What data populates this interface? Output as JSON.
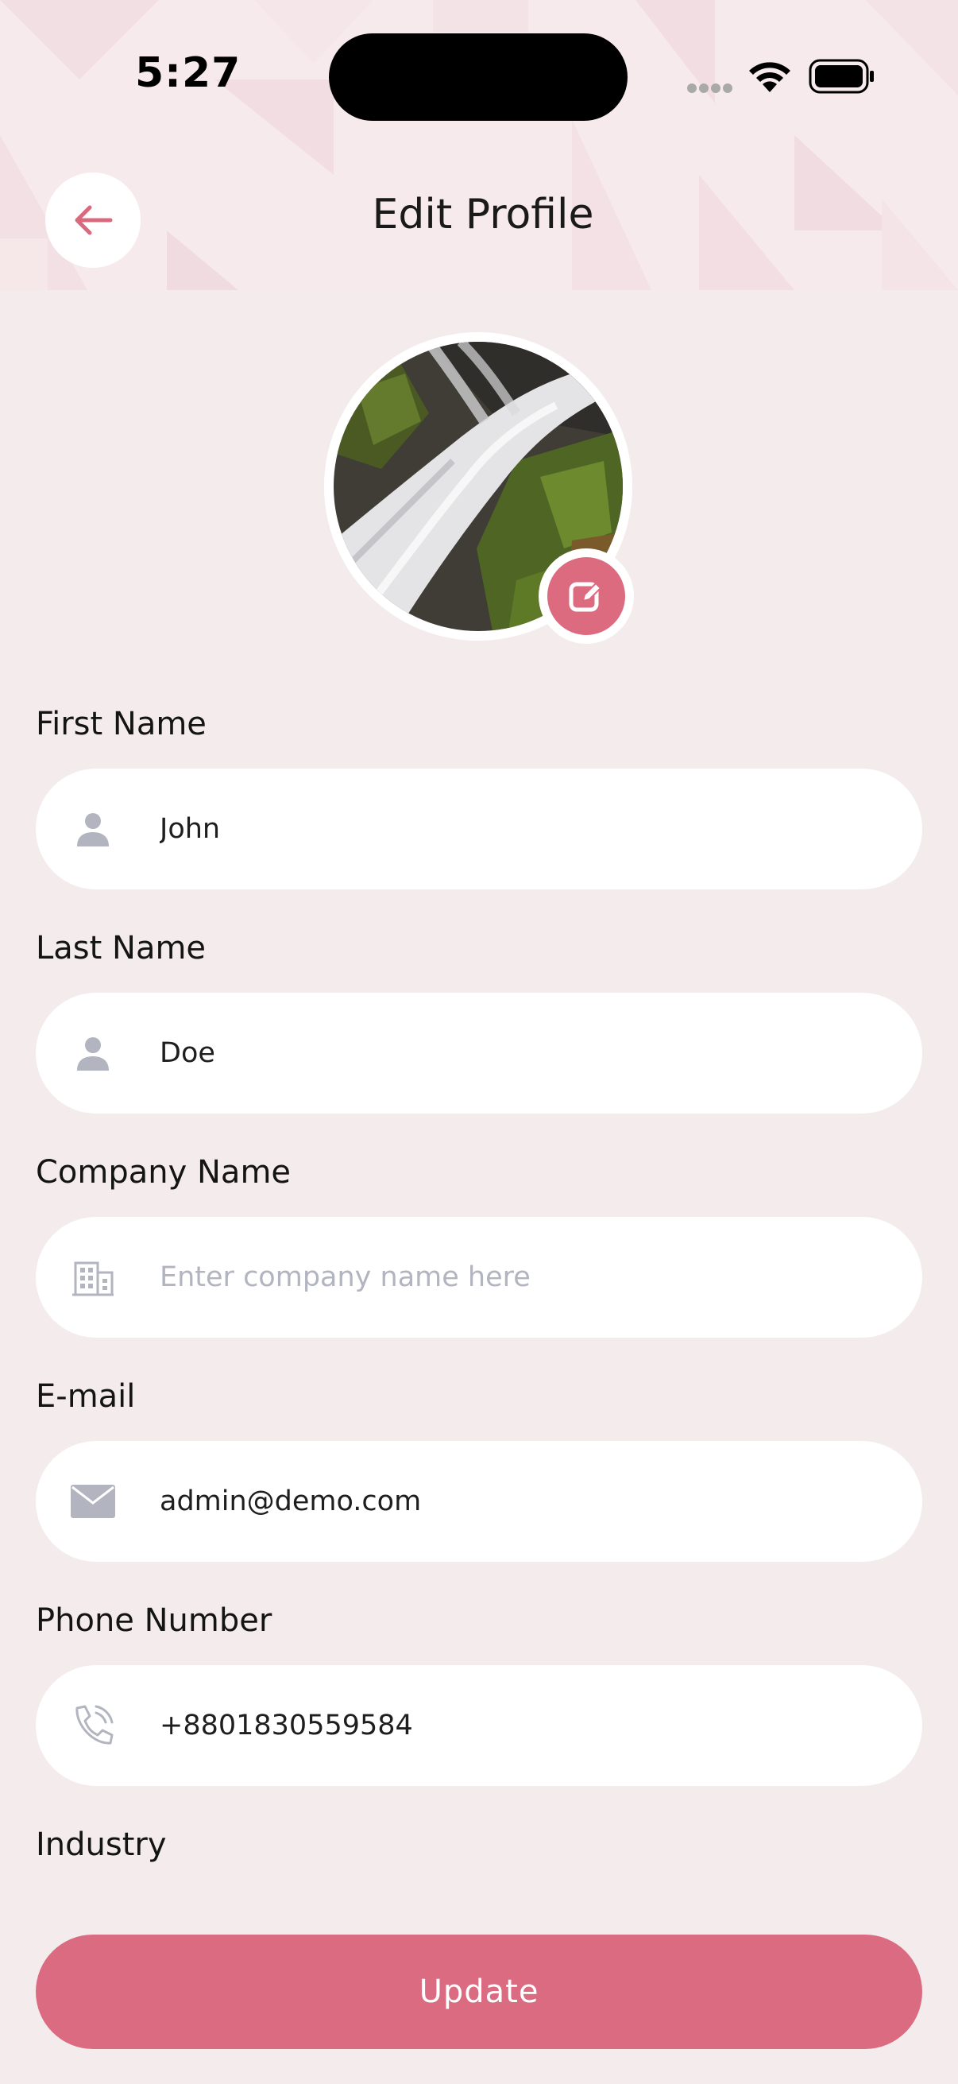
{
  "status_bar": {
    "time": "5:27"
  },
  "header": {
    "title": "Edit Profile",
    "back_icon": "arrow-left-icon"
  },
  "avatar": {
    "edit_icon": "edit-icon"
  },
  "form": {
    "first_name": {
      "label": "First Name",
      "value": "John",
      "icon": "person-icon"
    },
    "last_name": {
      "label": "Last Name",
      "value": "Doe",
      "icon": "person-icon"
    },
    "company_name": {
      "label": "Company Name",
      "value": "",
      "placeholder": "Enter company name here",
      "icon": "building-icon"
    },
    "email": {
      "label": "E-mail",
      "value": "admin@demo.com",
      "icon": "mail-icon"
    },
    "phone": {
      "label": "Phone Number",
      "value": "+8801830559584",
      "icon": "phone-icon"
    },
    "industry": {
      "label": "Industry"
    }
  },
  "actions": {
    "update_label": "Update"
  },
  "colors": {
    "accent": "#db6b80",
    "background": "#f4ecec",
    "field_background": "#ffffff",
    "icon_gray": "#b2b5bf"
  }
}
